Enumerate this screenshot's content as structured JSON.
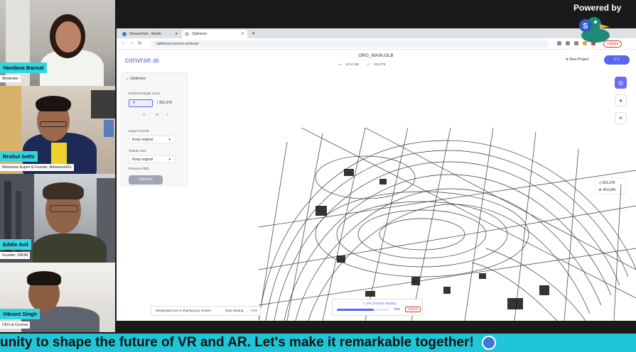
{
  "participants": [
    {
      "name": "Vandana Bansal",
      "role": "Moderator"
    },
    {
      "name": "Rrohul Sethi",
      "role": "Metaverse Expert & Founder, Metaverse911"
    },
    {
      "name": "Eddie Avil",
      "role": "Founder, XROM"
    },
    {
      "name": "Vikrant Singh",
      "role": "CEO at Convrse"
    }
  ],
  "branding": {
    "powered_by": "Powered by",
    "streamyard": "StreamYard"
  },
  "browser": {
    "tabs": [
      {
        "label": "StreamYard - Studio"
      },
      {
        "label": "Optimizer"
      }
    ],
    "new_tab": "+",
    "url": "optimizer.convrse.ai/viewer",
    "update": "Update"
  },
  "app": {
    "logo": "convrse.ai",
    "file_title": "ORG_MAIN.GLB",
    "file_size": "10.51 MB",
    "triangle_stat": "353,378",
    "new_project": "New Project",
    "user_button": "C 1"
  },
  "optimize_panel": {
    "title": "Optimize",
    "triangle_label": "Desired triangle count",
    "triangle_value": "0",
    "triangle_total": "353,378",
    "presets": [
      "H",
      "M",
      "L"
    ],
    "export_label": "Export Format",
    "export_value": "Keep original",
    "texture_label": "Texture Size",
    "texture_value": "Keep original",
    "pbr_label": "Preserve PBR",
    "button": "Optimize"
  },
  "counts": {
    "triangles": "353,378",
    "vertices": "453,945"
  },
  "share_bar": {
    "text": "streamyard.com is sharing your screen.",
    "stop": "Stop sharing",
    "hide": "Hide"
  },
  "upload": {
    "label": "UPLOADING MODEL",
    "percent_text": "70%",
    "progress": 0.7,
    "cancel": "Cancel"
  },
  "ticker": {
    "text": "unity to shape the future of VR and AR. Let's make it remarkable together!"
  },
  "colors": {
    "ticker": "#20c6d8",
    "name_tag": "#36d3e0",
    "accent": "#5865f2"
  }
}
